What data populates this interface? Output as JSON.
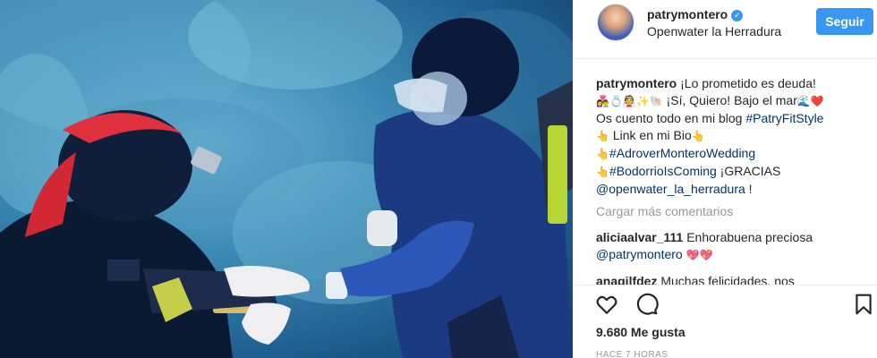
{
  "post": {
    "username": "patrymontero",
    "location": "Openwater la Herradura",
    "follow_label": "Seguir",
    "verified_mark": "✓"
  },
  "caption": {
    "user": "patrymontero",
    "line1": " ¡Lo prometido es deuda!",
    "line2_emoji": "👩‍❤️‍👨💍👰✨🐚",
    "line2_text": " ¡Sí, Quiero! Bajo el mar",
    "line2_emoji_end": "🌊❤️",
    "line3_text": "Os cuento todo en mi blog ",
    "line3_tag": "#PatryFitStyle",
    "line4_emoji": "👆",
    "line4_text": " Link en mi Bio",
    "line4_emoji_end": "👆",
    "line5_emoji": "👆",
    "line5_tag": "#AdroverMonteroWedding",
    "line6_emoji": "👆",
    "line6_tag": "#BodorrioIsComing",
    "line6_text": " ¡GRACIAS",
    "line7_mention": "@openwater_la_herradura",
    "line7_text": " !"
  },
  "load_more": "Cargar más comentarios",
  "comments": [
    {
      "user": "aliciaalvar_111",
      "text": " Enhorabuena preciosa",
      "mention": "@patrymontero",
      "emoji": "💖💖"
    },
    {
      "user": "anagilfdez",
      "text": " Muchas felicidades, nos"
    }
  ],
  "likes": "9.680 Me gusta",
  "time": "HACE 7 HORAS",
  "icons": {
    "heart": "heart-icon",
    "comment": "comment-icon",
    "bookmark": "bookmark-icon"
  },
  "colors": {
    "accent": "#3897f0",
    "link": "#003569",
    "muted": "#999999",
    "text": "#262626"
  }
}
